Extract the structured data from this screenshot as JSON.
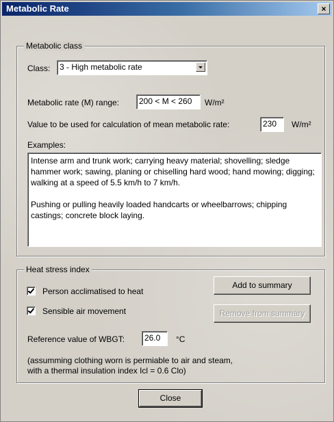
{
  "window": {
    "title": "Metabolic Rate",
    "close_glyph": "×"
  },
  "metabolic_class": {
    "group_title": "Metabolic class",
    "class_label": "Class:",
    "class_value": "3 - High metabolic rate",
    "range_label": "Metabolic rate (M) range:",
    "range_value": "200 < M < 260",
    "range_unit": "W/m²",
    "value_label": "Value to be used for calculation of mean metabolic rate:",
    "value": "230",
    "value_unit": "W/m²",
    "examples_label": "Examples:",
    "examples_text": "Intense arm and trunk work; carrying heavy material; shovelling; sledge hammer work; sawing, planing or chiselling hard wood; hand mowing; digging; walking at a speed of 5.5 km/h to 7 km/h.\n\nPushing or pulling heavily loaded handcarts or wheelbarrows; chipping castings; concrete block laying."
  },
  "heat_stress": {
    "group_title": "Heat stress index",
    "acclimatised_label": "Person acclimatised to heat",
    "acclimatised_checked": true,
    "air_movement_label": "Sensible air movement",
    "air_movement_checked": true,
    "add_button": "Add to summary",
    "remove_button": "Remove from summary",
    "wbgt_label": "Reference value of WBGT:",
    "wbgt_value": "26.0",
    "wbgt_unit": "°C",
    "note_line1": "(assumming clothing worn is permiable to air and steam,",
    "note_line2": "with a thermal insulation index Icl = 0.6 Clo)"
  },
  "footer": {
    "close_button": "Close"
  }
}
